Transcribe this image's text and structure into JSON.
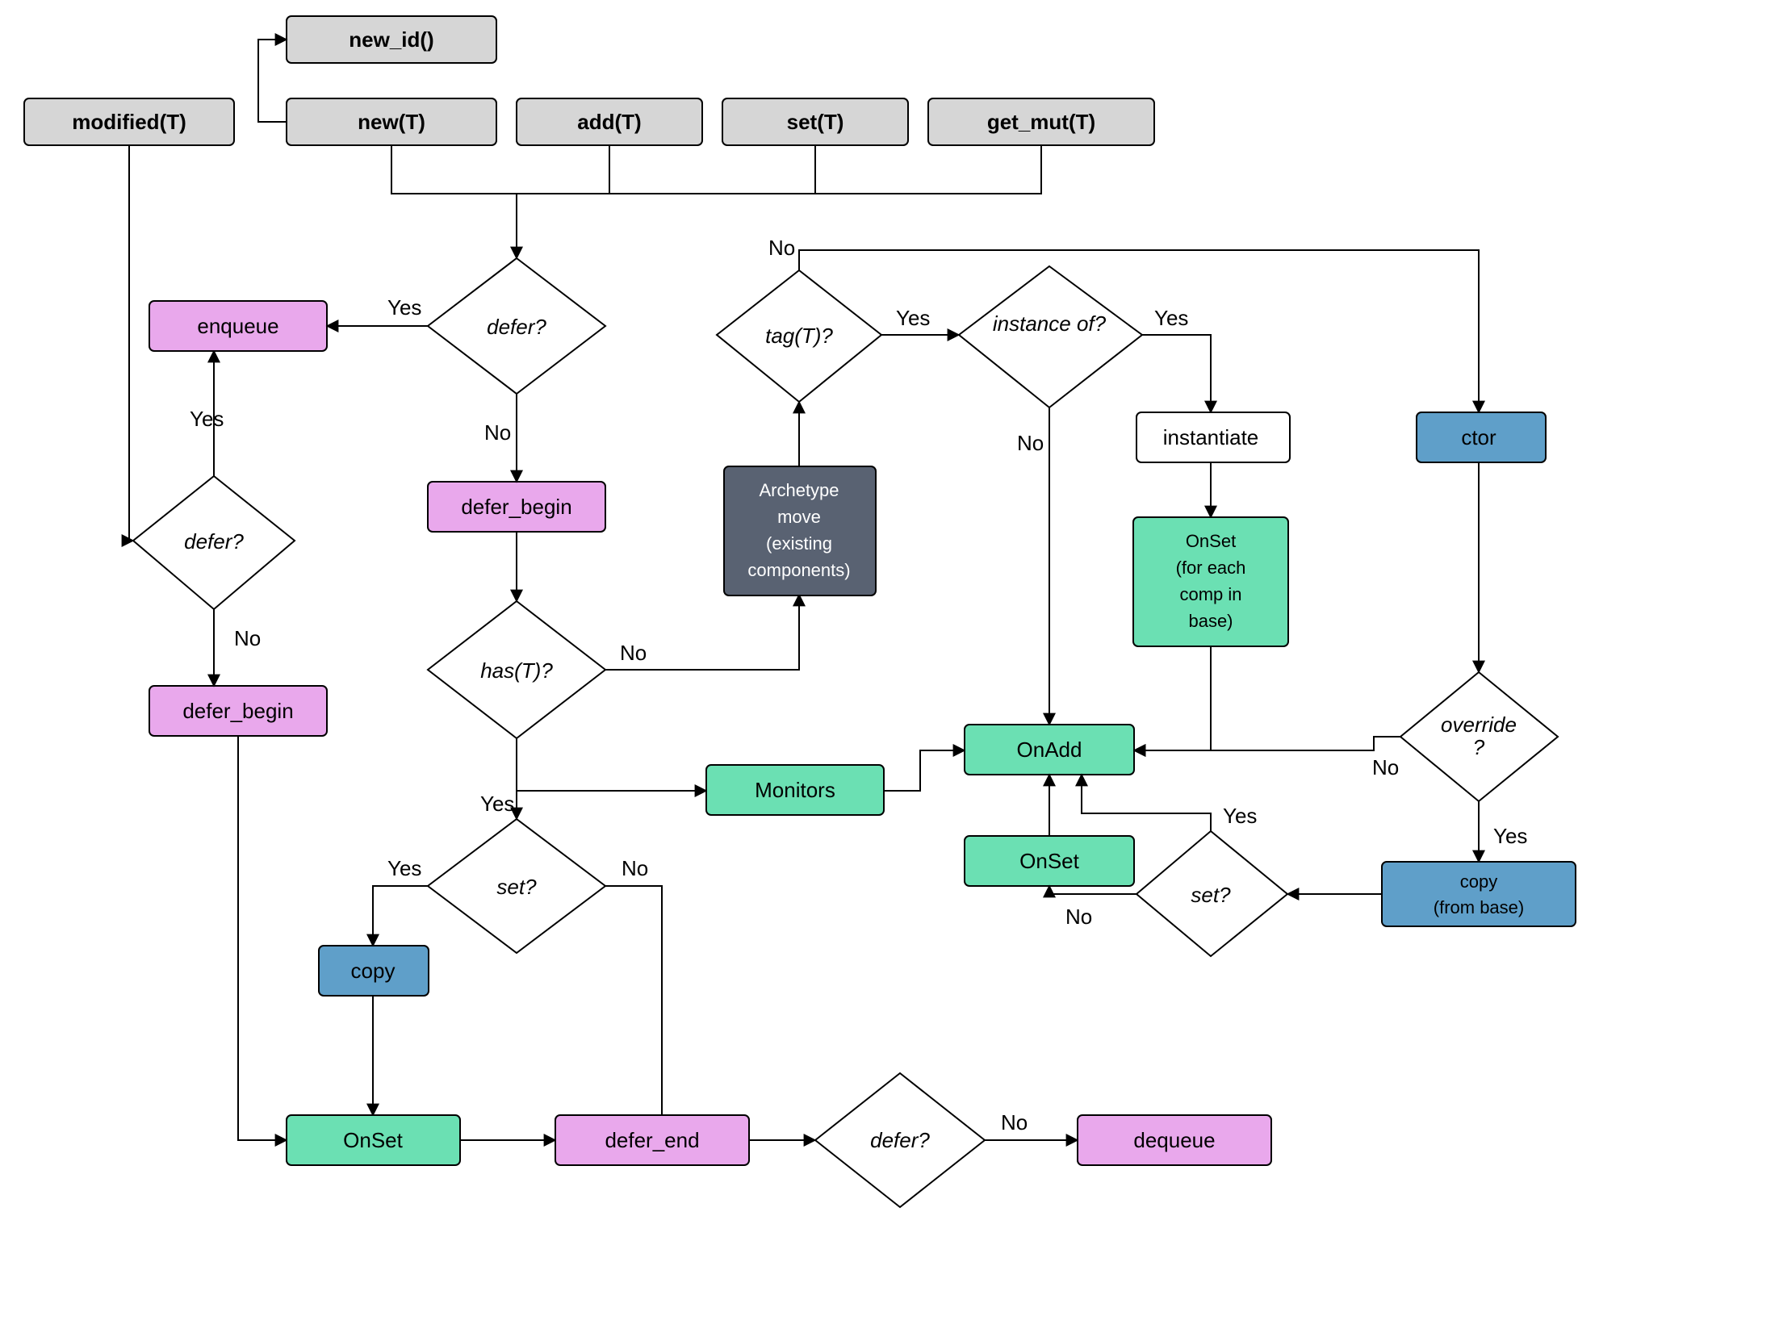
{
  "nodes": {
    "new_id": "new_id()",
    "modified": "modified(T)",
    "new": "new(T)",
    "add": "add(T)",
    "set_top": "set(T)",
    "get_mut": "get_mut(T)",
    "enqueue": "enqueue",
    "defer1": "defer?",
    "defer2": "defer?",
    "defer_begin1": "defer_begin",
    "defer_begin2": "defer_begin",
    "has_t": "has(T)?",
    "set_q": "set?",
    "copy": "copy",
    "onset1": "OnSet",
    "defer_end": "defer_end",
    "defer3": "defer?",
    "dequeue": "dequeue",
    "monitors": "Monitors",
    "tag_t": "tag(T)?",
    "archetype_l1": "Archetype",
    "archetype_l2": "move",
    "archetype_l3": "(existing",
    "archetype_l4": "components)",
    "instance_of": "instance of?",
    "instantiate": "instantiate",
    "onset_base_l1": "OnSet",
    "onset_base_l2": "(for each",
    "onset_base_l3": "comp in",
    "onset_base_l4": "base)",
    "onadd": "OnAdd",
    "onset2": "OnSet",
    "set_q2": "set?",
    "ctor": "ctor",
    "override_l1": "override",
    "override_l2": "?",
    "copy_base_l1": "copy",
    "copy_base_l2": "(from base)"
  },
  "labels": {
    "yes": "Yes",
    "no": "No"
  }
}
